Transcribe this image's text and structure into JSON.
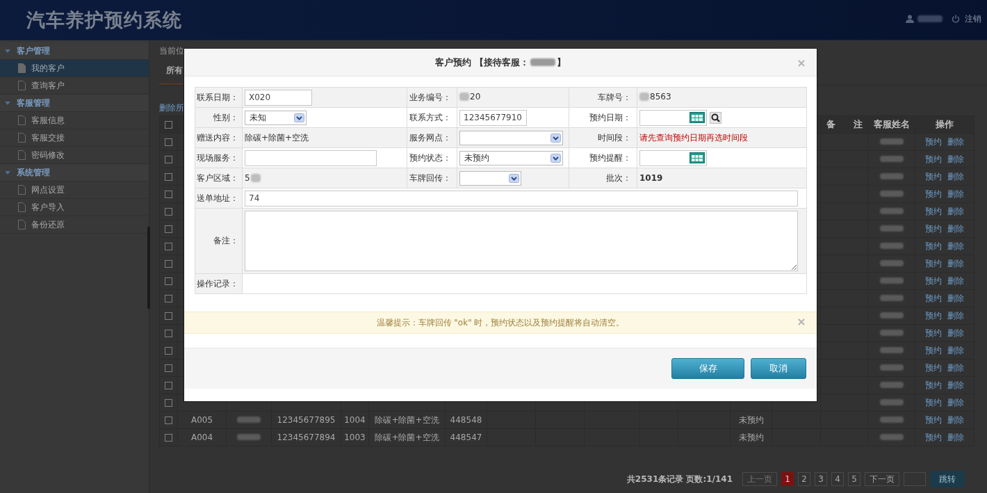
{
  "header": {
    "title": "汽车养护预约系统",
    "user_redacted": true,
    "logout": "注销"
  },
  "sidebar": [
    {
      "title": "客户管理",
      "expanded": true,
      "items": [
        {
          "label": "我的客户",
          "selected": true
        },
        {
          "label": "查询客户",
          "selected": false
        }
      ]
    },
    {
      "title": "客服管理",
      "expanded": true,
      "items": [
        {
          "label": "客服信息",
          "selected": false
        },
        {
          "label": "客服交接",
          "selected": false
        },
        {
          "label": "密码修改",
          "selected": false
        }
      ]
    },
    {
      "title": "系统管理",
      "expanded": true,
      "items": [
        {
          "label": "网点设置",
          "selected": false
        },
        {
          "label": "客户导入",
          "selected": false
        },
        {
          "label": "备份还原",
          "selected": false
        }
      ]
    }
  ],
  "breadcrumb": "当前位",
  "tab": {
    "label": "所有",
    "selected": true
  },
  "delete_link": "删除所",
  "table": {
    "header_checked": false,
    "headers": [
      "备　　注",
      "客服姓名",
      "操作"
    ],
    "rows": [
      {
        "checked": false,
        "agent_redacted": true,
        "actions": [
          "预约",
          "删除"
        ]
      },
      {
        "checked": false,
        "agent_redacted": true,
        "actions": [
          "预约",
          "删除"
        ]
      },
      {
        "checked": false,
        "agent_redacted": true,
        "actions": [
          "预约",
          "删除"
        ]
      },
      {
        "checked": false,
        "agent_redacted": true,
        "actions": [
          "预约",
          "删除"
        ]
      },
      {
        "checked": false,
        "agent_redacted": true,
        "actions": [
          "预约",
          "删除"
        ]
      },
      {
        "checked": false,
        "agent_redacted": true,
        "actions": [
          "预约",
          "删除"
        ]
      },
      {
        "checked": false,
        "agent_redacted": true,
        "actions": [
          "预约",
          "删除"
        ]
      },
      {
        "checked": false,
        "agent_redacted": true,
        "actions": [
          "预约",
          "删除"
        ]
      },
      {
        "checked": false,
        "agent_redacted": true,
        "actions": [
          "预约",
          "删除"
        ]
      },
      {
        "checked": false,
        "agent_redacted": true,
        "actions": [
          "预约",
          "删除"
        ]
      },
      {
        "checked": false,
        "agent_redacted": true,
        "actions": [
          "预约",
          "删除"
        ]
      },
      {
        "checked": false,
        "agent_redacted": true,
        "actions": [
          "预约",
          "删除"
        ]
      },
      {
        "checked": false,
        "agent_redacted": true,
        "actions": [
          "预约",
          "删除"
        ]
      },
      {
        "checked": false,
        "agent_redacted": true,
        "actions": [
          "预约",
          "删除"
        ]
      },
      {
        "checked": false,
        "agent_redacted": true,
        "actions": [
          "预约",
          "删除"
        ]
      },
      {
        "checked": false,
        "agent_redacted": true,
        "actions": [
          "预约",
          "删除"
        ]
      },
      {
        "checked": false,
        "id": "A005",
        "name_redacted": true,
        "phone": "12345677895",
        "number": "1004",
        "service": "除碳+除菌+空洗",
        "code": "448548",
        "status": "未预约",
        "agent_redacted": true,
        "actions": [
          "预约",
          "删除"
        ]
      },
      {
        "checked": false,
        "id": "A004",
        "name_redacted": true,
        "phone": "12345677894",
        "number": "1003",
        "service": "除碳+除菌+空洗",
        "code": "448547",
        "status": "未预约",
        "agent_redacted": true,
        "actions": [
          "预约",
          "删除"
        ]
      }
    ]
  },
  "pagination": {
    "summary": "共2531条记录 页数:1/141",
    "prev": {
      "label": "上一页",
      "disabled": true
    },
    "pages": [
      {
        "label": "1",
        "selected": true
      },
      {
        "label": "2",
        "selected": false
      },
      {
        "label": "3",
        "selected": false
      },
      {
        "label": "4",
        "selected": false
      },
      {
        "label": "5",
        "selected": false
      }
    ],
    "next": {
      "label": "下一页",
      "disabled": false
    },
    "go": "跳转"
  },
  "modal": {
    "title": "客户预约 【接待客服：",
    "title_end": "】",
    "agent_redacted": true,
    "rows": [
      {
        "cells": [
          {
            "label": "联系日期：",
            "kind": "input",
            "value": "X020"
          },
          {
            "label": "业务编号：",
            "kind": "text",
            "value": "20",
            "redacted": true
          },
          {
            "label": "车牌号：",
            "kind": "text",
            "value": "8563",
            "redacted": true
          }
        ]
      },
      {
        "cells": [
          {
            "label": "性别：",
            "kind": "select",
            "value": "未知"
          },
          {
            "label": "联系方式：",
            "kind": "input",
            "value": "12345677910"
          },
          {
            "label": "预约日期：",
            "kind": "datesearch"
          }
        ]
      },
      {
        "cells": [
          {
            "label": "赠送内容：",
            "kind": "text",
            "value": "除碳+除菌+空洗"
          },
          {
            "label": "服务网点：",
            "kind": "wideselect"
          },
          {
            "label": "时间段：",
            "kind": "error",
            "value": "请先查询预约日期再选时间段"
          }
        ]
      },
      {
        "cells": [
          {
            "label": "现场服务：",
            "kind": "longinput"
          },
          {
            "label": "预约状态：",
            "kind": "wideselect",
            "value": "未预约"
          },
          {
            "label": "预约提醒：",
            "kind": "date"
          }
        ]
      },
      {
        "cells": [
          {
            "label": "客户区域：",
            "kind": "text",
            "value": "5",
            "redacted": true
          },
          {
            "label": "车牌回传：",
            "kind": "smallselect"
          },
          {
            "label": "批次：",
            "kind": "bold",
            "value": "1019"
          }
        ]
      },
      {
        "cells": [
          {
            "label": "送单地址：",
            "kind": "fullinput",
            "value": "74"
          }
        ]
      },
      {
        "cells": [
          {
            "label": "备注：",
            "kind": "textarea"
          }
        ]
      },
      {
        "cells": [
          {
            "label": "操作记录：",
            "kind": "blank"
          }
        ]
      }
    ],
    "tip": "温馨提示：车牌回传 \"ok\" 时，预约状态以及预约提醒将自动清空。",
    "buttons": [
      {
        "label": "保存",
        "kind": "primary"
      },
      {
        "label": "取消",
        "kind": "primary"
      }
    ]
  }
}
